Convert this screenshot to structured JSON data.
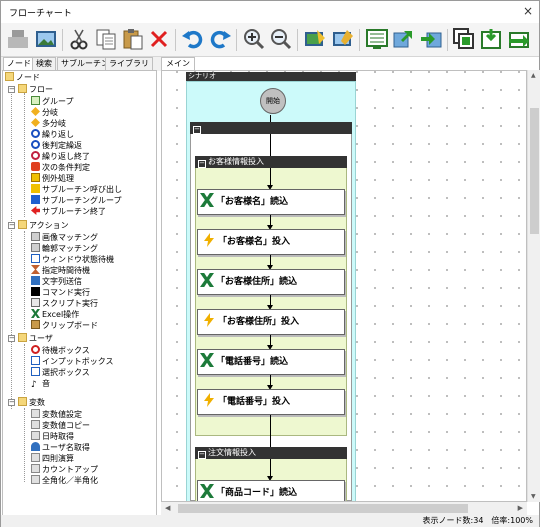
{
  "window": {
    "title": "フローチャート",
    "close": "×"
  },
  "toolbar": [
    {
      "icon": "stop-icon"
    },
    {
      "icon": "image-icon"
    },
    {
      "icon": "cut-icon"
    },
    {
      "icon": "copy-icon"
    },
    {
      "icon": "paste-icon"
    },
    {
      "icon": "delete-icon"
    },
    {
      "icon": "undo-icon"
    },
    {
      "icon": "redo-icon"
    },
    {
      "icon": "zoom-in-icon"
    },
    {
      "icon": "zoom-out-icon"
    },
    {
      "icon": "screen-edit-icon"
    },
    {
      "icon": "screen-settings-icon"
    },
    {
      "icon": "flow-grid-icon"
    },
    {
      "icon": "flow-export-icon"
    },
    {
      "icon": "flow-import-icon"
    },
    {
      "icon": "copy-flow-icon"
    },
    {
      "icon": "insert-icon"
    },
    {
      "icon": "switch-icon"
    }
  ],
  "left_tabs": [
    "ノード",
    "検索",
    "サブルーチン",
    "ライブラリ"
  ],
  "tree": {
    "root": "ノード",
    "flow": {
      "label": "フロー",
      "items": [
        "グループ",
        "分岐",
        "多分岐",
        "繰り返し",
        "後判定繰返",
        "繰り返し終了",
        "次の条件判定",
        "例外処理",
        "サブルーチン呼び出し",
        "サブルーチングループ",
        "サブルーチン終了"
      ]
    },
    "action": {
      "label": "アクション",
      "items": [
        "画像マッチング",
        "輪郭マッチング",
        "ウィンドウ状態待機",
        "指定時間待機",
        "文字列送信",
        "コマンド実行",
        "スクリプト実行",
        "Excel操作",
        "クリップボード"
      ]
    },
    "user": {
      "label": "ユーザ",
      "items": [
        "待機ボックス",
        "インプットボックス",
        "選択ボックス",
        "音"
      ]
    },
    "variable": {
      "label": "変数",
      "items": [
        "変数値設定",
        "変数値コピー",
        "日時取得",
        "ユーザ名取得",
        "四則演算",
        "カウントアップ",
        "全角化／半角化"
      ]
    }
  },
  "canvas_tab": "メイン",
  "canvas": {
    "scenario_label": "シナリオ",
    "start_label": "開始",
    "outer_group_toggle": "−",
    "groups": [
      {
        "label": "お客様情報投入",
        "nodes": [
          {
            "type": "excel",
            "label": "「お客様名」読込"
          },
          {
            "type": "send",
            "label": "「お客様名」投入"
          },
          {
            "type": "excel",
            "label": "「お客様住所」読込"
          },
          {
            "type": "send",
            "label": "「お客様住所」投入"
          },
          {
            "type": "excel",
            "label": "「電話番号」読込"
          },
          {
            "type": "send",
            "label": "「電話番号」投入"
          }
        ]
      },
      {
        "label": "注文情報投入",
        "nodes": [
          {
            "type": "excel",
            "label": "「商品コード」読込"
          }
        ]
      }
    ]
  },
  "status": {
    "text": "表示ノード数:34　倍率:100%"
  }
}
